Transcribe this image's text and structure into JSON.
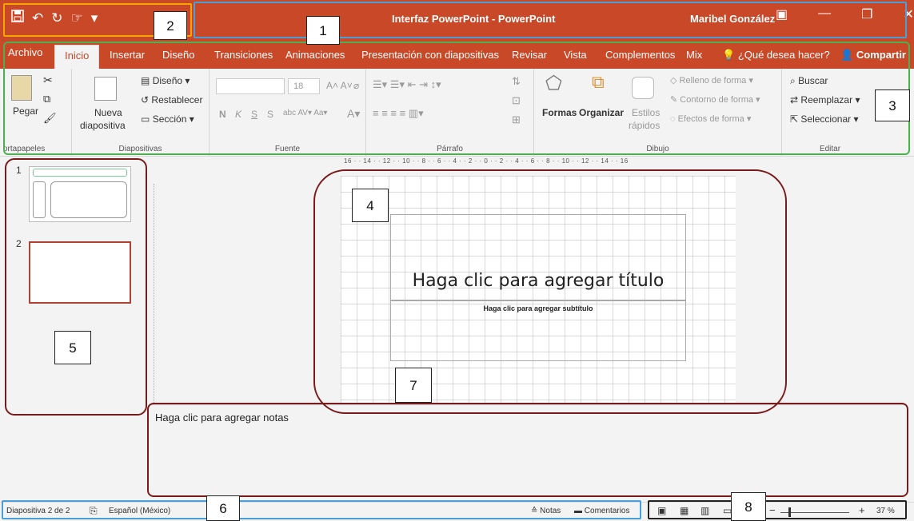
{
  "titlebar": {
    "title": "Interfaz PowerPoint - PowerPoint",
    "user": "Maribel González",
    "qat_icons": [
      "save-icon",
      "undo-icon",
      "redo-icon",
      "touch-mode-icon",
      "customize-qat-icon"
    ],
    "controls": [
      "ribbon-display-icon",
      "minimize-icon",
      "restore-icon",
      "close-icon"
    ],
    "brand_color": "#c84828"
  },
  "tabs": [
    "Archivo",
    "Inicio",
    "Insertar",
    "Diseño",
    "Transiciones",
    "Animaciones",
    "Presentación con diapositivas",
    "Revisar",
    "Vista",
    "Complementos",
    "Mix",
    "¿Qué desea hacer?"
  ],
  "active_tab": "Inicio",
  "share_label": "Compartir",
  "ribbon": {
    "clipboard": {
      "label": "ortapapeles",
      "paste": "Pegar"
    },
    "slides": {
      "label": "Diapositivas",
      "new_slide_1": "Nueva",
      "new_slide_2": "diapositiva",
      "layout": "Diseño",
      "reset": "Restablecer",
      "section": "Sección"
    },
    "font": {
      "label": "Fuente",
      "size": "18",
      "bold": "N",
      "italic": "K",
      "underline": "S",
      "strike": "S"
    },
    "paragraph": {
      "label": "Párrafo"
    },
    "drawing": {
      "label": "Dibujo",
      "shapes": "Formas",
      "arrange": "Organizar",
      "quick_styles_1": "Estilos",
      "quick_styles_2": "rápidos",
      "fill": "Relleno de forma",
      "outline": "Contorno de forma",
      "effects": "Efectos de forma"
    },
    "editing": {
      "label": "Editar",
      "find": "Buscar",
      "replace": "Reemplazar",
      "select": "Seleccionar"
    }
  },
  "ruler_text": "16 · · 14 · · 12 · · 10 · · 8 · · 6 · · 4 · · 2 · · 0 · · 2 · · 4 · · 6 · · 8 · · 10 · · 12 · · 14 · · 16",
  "thumbnails": [
    {
      "number": "1"
    },
    {
      "number": "2"
    }
  ],
  "slide": {
    "title_placeholder": "Haga clic para agregar título",
    "subtitle_placeholder": "Haga clic para agregar subtítulo"
  },
  "notes_placeholder": "Haga clic para agregar notas",
  "status": {
    "slide_info": "Diapositiva 2 de 2",
    "language": "Español (México)",
    "notes": "Notas",
    "comments": "Comentarios",
    "zoom": "37 %"
  },
  "callouts": [
    "1",
    "2",
    "3",
    "4",
    "5",
    "6",
    "7",
    "8"
  ],
  "frame_colors": {
    "title": "#4a9fd8",
    "qat": "#f4a600",
    "ribbon": "#4caf50",
    "regions": "#7a1a1a",
    "status": "#4a9fd8",
    "view": "#222222"
  }
}
